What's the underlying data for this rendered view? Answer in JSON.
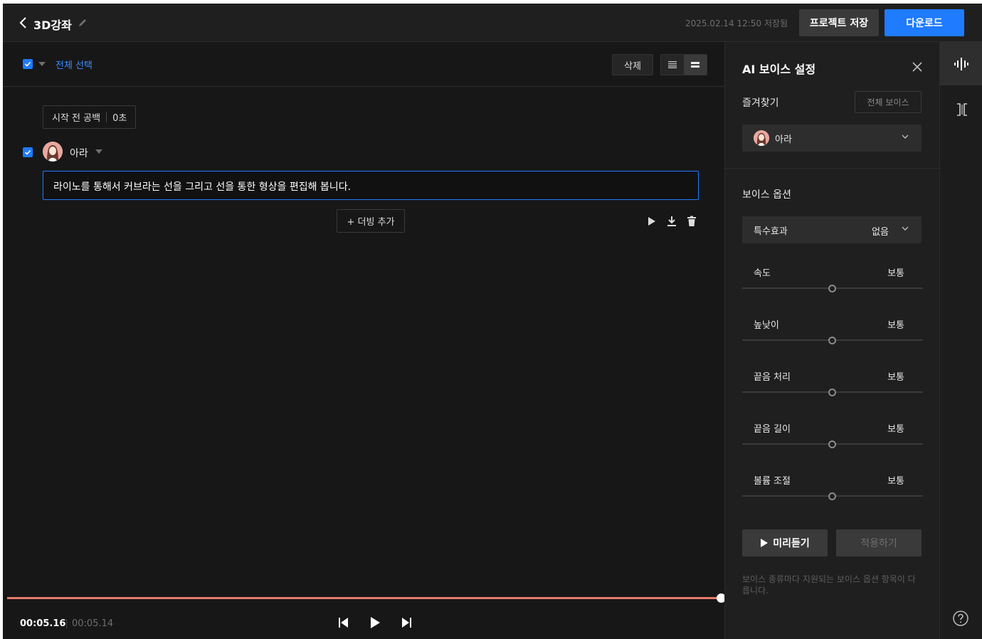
{
  "header": {
    "title": "3D강좌",
    "saved_text": "2025.02.14 12:50 저장됨",
    "save_label": "프로젝트 저장",
    "download_label": "다운로드"
  },
  "toolbar": {
    "select_all_label": "전체 선택",
    "delete_label": "삭제"
  },
  "script": {
    "gap_label": "시작 전 공백",
    "gap_value": "0초",
    "voice_name": "아라",
    "text": "라이노를 통해서 커브라는 선을 그리고 선을 통한 형상을 편집해 봅니다.",
    "add_dub_label": "+ 더빙 추가"
  },
  "timeline": {
    "current_time": "00:05.16",
    "total_time": "00:05.14",
    "progress": 1.0
  },
  "panel": {
    "title": "AI 보이스 설정",
    "favorites_label": "즐겨찾기",
    "all_voices_label": "전체 보이스",
    "favorite_voice": "아라",
    "voice_options_label": "보이스 옵션",
    "effect_label": "특수효과",
    "effect_value": "없음",
    "sliders": [
      {
        "label": "속도",
        "value": "보통",
        "level": 0.5
      },
      {
        "label": "높낮이",
        "value": "보통",
        "level": 0.5
      },
      {
        "label": "끝음 처리",
        "value": "보통",
        "level": 0.5
      },
      {
        "label": "끝음 길이",
        "value": "보통",
        "level": 0.5
      },
      {
        "label": "볼륨 조절",
        "value": "보통",
        "level": 0.5
      }
    ],
    "preview_label": "미리듣기",
    "apply_label": "적용하기",
    "note": "보이스 종류마다 지원되는 보이스 옵션 항목이 다릅니다."
  },
  "colors": {
    "accent": "#1f7bff",
    "progress": "#e87a6a",
    "background": "#181818",
    "panel": "#1f1f1f"
  },
  "icons": [
    "back-icon",
    "pencil-icon",
    "checkbox-icon",
    "caret-down-icon",
    "list-view-icon",
    "card-view-icon",
    "play-icon",
    "download-icon",
    "trash-icon",
    "skip-back-icon",
    "skip-forward-icon",
    "close-icon",
    "chevron-down-icon",
    "waveform-icon",
    "split-icon",
    "help-icon"
  ]
}
